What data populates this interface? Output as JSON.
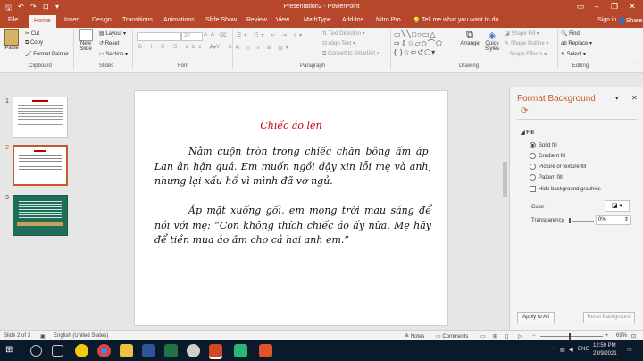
{
  "window": {
    "title": "Presentation2 - PowerPoint"
  },
  "tabs": [
    "File",
    "Home",
    "Insert",
    "Design",
    "Transitions",
    "Animations",
    "Slide Show",
    "Review",
    "View",
    "MathType",
    "Add-Ins",
    "Nitro Pro"
  ],
  "tell_me": "Tell me what you want to do...",
  "account": {
    "signin": "Sign in",
    "share": "Share"
  },
  "ribbon": {
    "clipboard": {
      "paste": "Paste",
      "cut": "Cut",
      "copy": "Copy",
      "format_painter": "Format Painter",
      "group": "Clipboard"
    },
    "slides": {
      "new_slide": "New",
      "new_slide2": "Slide",
      "layout": "Layout",
      "reset": "Reset",
      "section": "Section",
      "group": "Slides"
    },
    "font": {
      "size": "20",
      "group": "Font"
    },
    "paragraph": {
      "text_direction": "Text Direction",
      "align_text": "Align Text",
      "smartart": "Convert to SmartArt",
      "group": "Paragraph"
    },
    "drawing": {
      "arrange": "Arrange",
      "quick_styles": "Quick",
      "quick_styles2": "Styles",
      "shape_fill": "Shape Fill",
      "shape_outline": "Shape Outline",
      "shape_effects": "Shape Effects",
      "group": "Drawing"
    },
    "editing": {
      "find": "Find",
      "replace": "Replace",
      "select": "Select",
      "group": "Editing"
    }
  },
  "thumbnails": {
    "numbers": [
      "1",
      "2",
      "3"
    ],
    "selected": 2
  },
  "slide": {
    "title": "Chiếc áo len",
    "paragraph1": "Nằm cuộn tròn trong chiếc chăn bông ấm áp, Lan ân hận quá. Em muốn ngồi dậy xin lỗi mẹ và anh, nhưng lại xấu hổ vì mình đã vờ ngủ.",
    "paragraph2": "Áp mặt xuống gối, em mong trời mau sáng để nói với mẹ: “Con không thích chiếc áo ấy nữa. Mẹ hãy để tiền mua áo ấm cho cả hai anh em.”"
  },
  "format_pane": {
    "title": "Format Background",
    "section": "Fill",
    "options": [
      "Solid fill",
      "Gradient fill",
      "Picture or texture fill",
      "Pattern fill"
    ],
    "selected_option": "Solid fill",
    "hide_graphics": "Hide background graphics",
    "color_label": "Color",
    "transparency_label": "Transparency",
    "transparency_value": "0%",
    "apply_all": "Apply to All",
    "reset_background": "Reset Background"
  },
  "statusbar": {
    "slide_info": "Slide 2 of 3",
    "language": "English (United States)",
    "notes": "Notes",
    "comments": "Comments",
    "zoom": "69%"
  },
  "taskbar": {
    "lang": "ENG",
    "time": "12:59 PM",
    "date": "23/9/2021"
  },
  "colors": {
    "accent": "#b7472a",
    "title_red": "#c00000",
    "selected_border": "#c55a2e",
    "taskbar": "#0b1a2a"
  }
}
